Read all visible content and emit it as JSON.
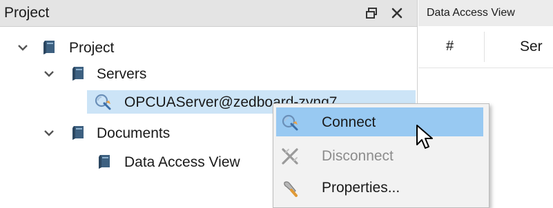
{
  "project_panel": {
    "title": "Project",
    "float_button_icon": "float-window-icon",
    "close_button_icon": "close-icon",
    "tree": {
      "root": {
        "label": "Project",
        "icon": "book-icon",
        "expanded": true
      },
      "servers": {
        "label": "Servers",
        "icon": "book-icon",
        "expanded": true
      },
      "server": {
        "label": "OPCUAServer@zedboard-zynq7",
        "icon": "server-connection-icon",
        "selected": true
      },
      "documents": {
        "label": "Documents",
        "icon": "book-icon",
        "expanded": true
      },
      "data_access_view": {
        "label": "Data Access View",
        "icon": "book-icon"
      }
    }
  },
  "data_access_view": {
    "tab_label": "Data Access View",
    "columns": [
      "#",
      "Ser"
    ]
  },
  "context_menu": {
    "items": [
      {
        "label": "Connect",
        "icon": "connect-icon",
        "enabled": true,
        "highlighted": true
      },
      {
        "label": "Disconnect",
        "icon": "disconnect-icon",
        "enabled": false
      },
      {
        "label": "Properties...",
        "icon": "wrench-icon",
        "enabled": true
      }
    ]
  },
  "colors": {
    "panel_header_bg": "#e4e4e4",
    "selection_bg": "#cce4f7",
    "menu_highlight": "#98c9f2",
    "menu_bg": "#f2f2f2",
    "disabled_text": "#8c8c8c"
  }
}
